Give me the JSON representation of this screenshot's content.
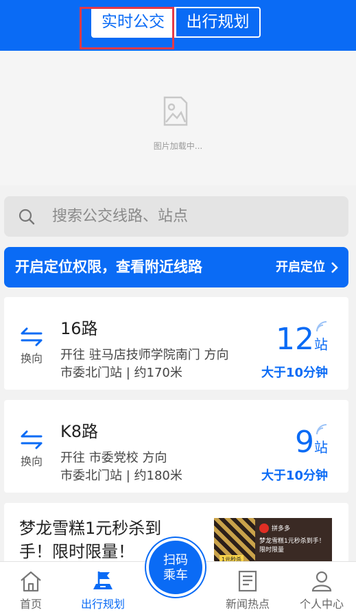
{
  "header": {
    "tabs": [
      {
        "label": "实时公交",
        "active": true
      },
      {
        "label": "出行规划",
        "active": false
      }
    ]
  },
  "banner": {
    "loading_text": "图片加载中..."
  },
  "search": {
    "placeholder": "搜索公交线路、站点"
  },
  "location": {
    "title": "开启定位权限，查看附近线路",
    "action": "开启定位"
  },
  "routes": [
    {
      "swap_label": "换向",
      "name": "16路",
      "direction": "开往 驻马店技师学院南门 方向",
      "stop": "市委北门站 | 约170米",
      "stations": "12",
      "station_unit": "站",
      "eta": "大于10分钟"
    },
    {
      "swap_label": "换向",
      "name": "K8路",
      "direction": "开往 市委党校 方向",
      "stop": "市委北门站 | 约180米",
      "stations": "9",
      "station_unit": "站",
      "eta": "大于10分钟"
    }
  ],
  "ad": {
    "text": "梦龙雪糕1元秒杀到手！限时限量！",
    "image_brand": "拼多多",
    "image_caption": "梦龙雪糕1元秒杀到手！限时限量",
    "image_badge": "1元秒杀"
  },
  "tabbar": {
    "home": "首页",
    "plan": "出行规划",
    "scan": "扫码\n乘车",
    "scan_line1": "扫码",
    "scan_line2": "乘车",
    "news": "新闻热点",
    "me": "个人中心"
  },
  "colors": {
    "primary": "#0a6bf5",
    "highlight": "#e63946"
  }
}
